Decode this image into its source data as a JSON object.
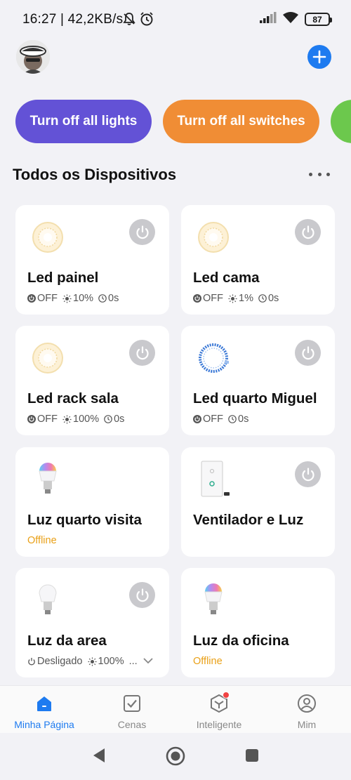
{
  "status_bar": {
    "time_speed": "16:27 | 42,2KB/s",
    "battery": "87"
  },
  "header": {
    "avatar_icon": "user-avatar",
    "add_icon": "plus-icon"
  },
  "quick_actions": [
    {
      "label": "Turn off all lights",
      "color": "#6352d6"
    },
    {
      "label": "Turn off all switches",
      "color": "#f08d35"
    },
    {
      "label": "",
      "color": "#6cc84d"
    }
  ],
  "section": {
    "title": "Todos os Dispositivos"
  },
  "devices": [
    {
      "name": "Led painel",
      "status": "OFF",
      "brightness": "10%",
      "timer": "0s",
      "icon": "round-led-panel-icon"
    },
    {
      "name": "Led cama",
      "status": "OFF",
      "brightness": "1%",
      "timer": "0s",
      "icon": "round-led-panel-icon"
    },
    {
      "name": "Led rack sala",
      "status": "OFF",
      "brightness": "100%",
      "timer": "0s",
      "icon": "round-led-panel-icon"
    },
    {
      "name": "Led quarto Miguel",
      "status": "OFF",
      "timer": "0s",
      "icon": "led-strip-icon"
    },
    {
      "name": "Luz quarto visita",
      "offline": "Offline",
      "icon": "rgb-bulb-icon"
    },
    {
      "name": "Ventilador e Luz",
      "icon": "wall-switch-icon"
    },
    {
      "name": "Luz da area",
      "status": "Desligado",
      "brightness": "100%",
      "more": "...",
      "icon": "white-bulb-icon"
    },
    {
      "name": "Luz da oficina",
      "offline": "Offline",
      "icon": "rgb-bulb-icon"
    }
  ],
  "bottom_nav": [
    {
      "label": "Minha Página",
      "icon": "home-icon",
      "active": true
    },
    {
      "label": "Cenas",
      "icon": "scenes-checkbox-icon"
    },
    {
      "label": "Inteligente",
      "icon": "smart-cube-icon",
      "badge": true
    },
    {
      "label": "Mim",
      "icon": "profile-icon"
    }
  ],
  "colors": {
    "accent": "#1e7bf0",
    "offline": "#e9a017",
    "background": "#f2f2f6"
  }
}
